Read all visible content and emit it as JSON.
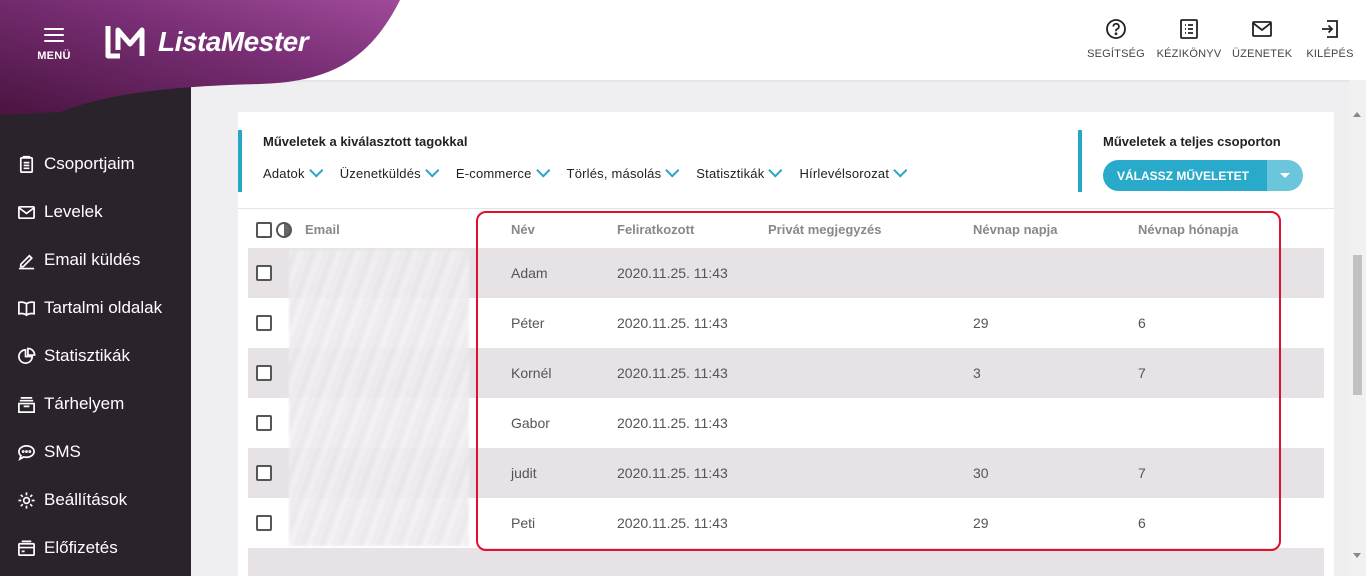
{
  "header": {
    "menu_label": "MENÜ",
    "logo_text": "ListaMester",
    "actions": [
      {
        "label": "SEGÍTSÉG",
        "icon": "help-icon"
      },
      {
        "label": "KÉZIKÖNYV",
        "icon": "manual-icon"
      },
      {
        "label": "ÜZENETEK",
        "icon": "mail-icon"
      },
      {
        "label": "KILÉPÉS",
        "icon": "logout-icon"
      }
    ]
  },
  "sidebar": {
    "items": [
      {
        "label": "Csoportjaim",
        "icon": "clipboard-icon"
      },
      {
        "label": "Levelek",
        "icon": "envelope-icon"
      },
      {
        "label": "Email küldés",
        "icon": "pen-icon"
      },
      {
        "label": "Tartalmi oldalak",
        "icon": "book-icon"
      },
      {
        "label": "Statisztikák",
        "icon": "pie-chart-icon"
      },
      {
        "label": "Tárhelyem",
        "icon": "storage-icon"
      },
      {
        "label": "SMS",
        "icon": "chat-icon"
      },
      {
        "label": "Beállítások",
        "icon": "gear-icon"
      },
      {
        "label": "Előfizetés",
        "icon": "subscription-icon"
      }
    ]
  },
  "ops": {
    "selected_title": "Műveletek a kiválasztott tagokkal",
    "menus": [
      "Adatok",
      "Üzenetküldés",
      "E-commerce",
      "Törlés, másolás",
      "Statisztikák",
      "Hírlevélsorozat"
    ],
    "group_title": "Műveletek a teljes csoporton",
    "group_button": "VÁLASSZ MŰVELETET"
  },
  "table": {
    "columns": {
      "email": "Email",
      "nev": "Név",
      "feliratkozott": "Feliratkozott",
      "privat": "Privát megjegyzés",
      "nevnap_napja": "Névnap napja",
      "nevnap_honapja": "Névnap hónapja"
    },
    "rows": [
      {
        "nev": "Adam",
        "feliratkozott": "2020.11.25. 11:43",
        "privat": "",
        "nap": "",
        "honap": ""
      },
      {
        "nev": "Péter",
        "feliratkozott": "2020.11.25. 11:43",
        "privat": "",
        "nap": "29",
        "honap": "6"
      },
      {
        "nev": "Kornél",
        "feliratkozott": "2020.11.25. 11:43",
        "privat": "",
        "nap": "3",
        "honap": "7"
      },
      {
        "nev": "Gabor",
        "feliratkozott": "2020.11.25. 11:43",
        "privat": "",
        "nap": "",
        "honap": ""
      },
      {
        "nev": "judit",
        "feliratkozott": "2020.11.25. 11:43",
        "privat": "",
        "nap": "30",
        "honap": "7"
      },
      {
        "nev": "Peti",
        "feliratkozott": "2020.11.25. 11:43",
        "privat": "",
        "nap": "29",
        "honap": "6"
      }
    ]
  },
  "colors": {
    "accent": "#28a8c4",
    "sidebar": "#2b232c",
    "brand_gradient_start": "#5a1848",
    "brand_gradient_end": "#a04a9a",
    "highlight": "#e0102e"
  }
}
